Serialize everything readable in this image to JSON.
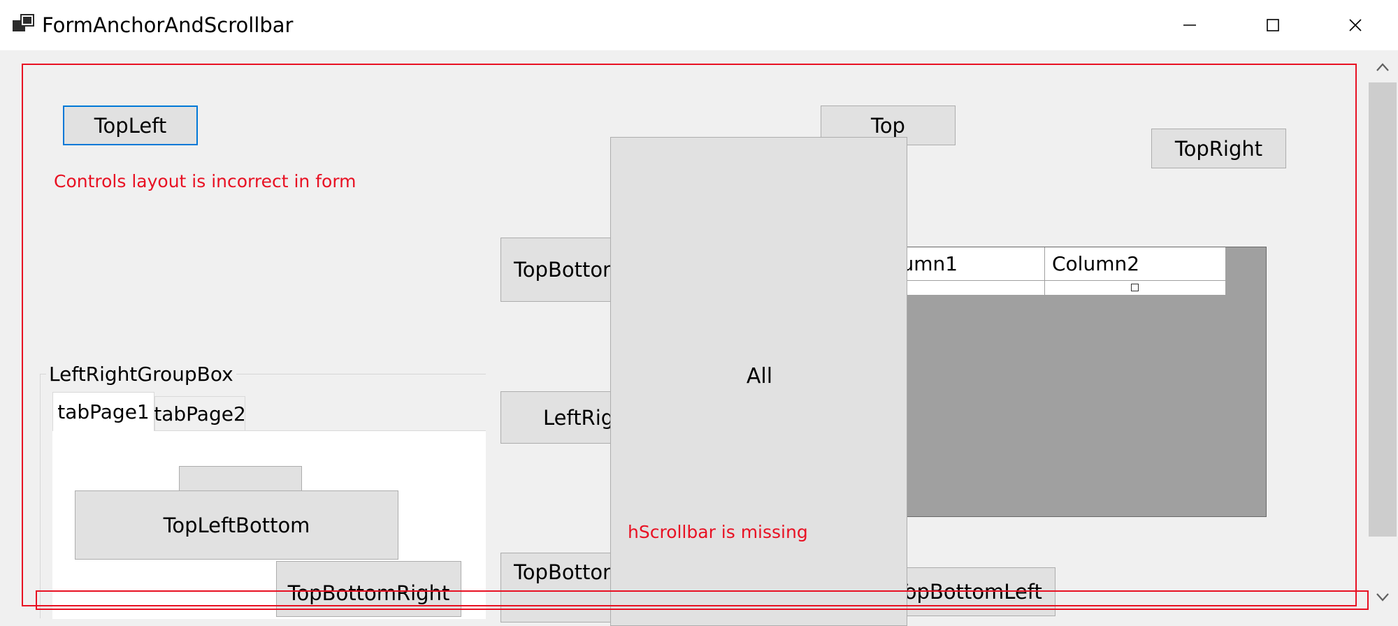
{
  "window": {
    "title": "FormAnchorAndScrollbar"
  },
  "buttons": {
    "top_left": "TopLeft",
    "top": "Top",
    "top_right": "TopRight",
    "top_bottom": "TopBottom",
    "left_right": "LeftRight",
    "top_bottom_lower": "TopBottom",
    "all": "All",
    "top_bottom_left": "TopBottomLeft"
  },
  "groupbox": {
    "label": "LeftRightGroupBox",
    "tabs": [
      {
        "label": "tabPage1",
        "selected": true
      },
      {
        "label": "tabPage2",
        "selected": false
      }
    ],
    "buttons": {
      "small": "",
      "top_left_bottom": "TopLeftBottom",
      "top_bottom_right": "TopBottomRight"
    }
  },
  "datagrid": {
    "columns": [
      "Column1",
      "Column2"
    ]
  },
  "annotations": {
    "layout_issue": "Controls layout is incorrect in form",
    "hscrollbar_issue": "hScrollbar is missing"
  },
  "icons": {
    "app": "app-window-icon",
    "minimize": "minimize-icon",
    "maximize": "maximize-icon",
    "close": "close-icon",
    "scroll_up": "chevron-up-icon",
    "scroll_down": "chevron-down-icon"
  },
  "colors": {
    "annotation_red": "#e81123",
    "focus_blue": "#0078d7",
    "button_face": "#e1e1e1",
    "grid_background": "#a0a0a0"
  }
}
